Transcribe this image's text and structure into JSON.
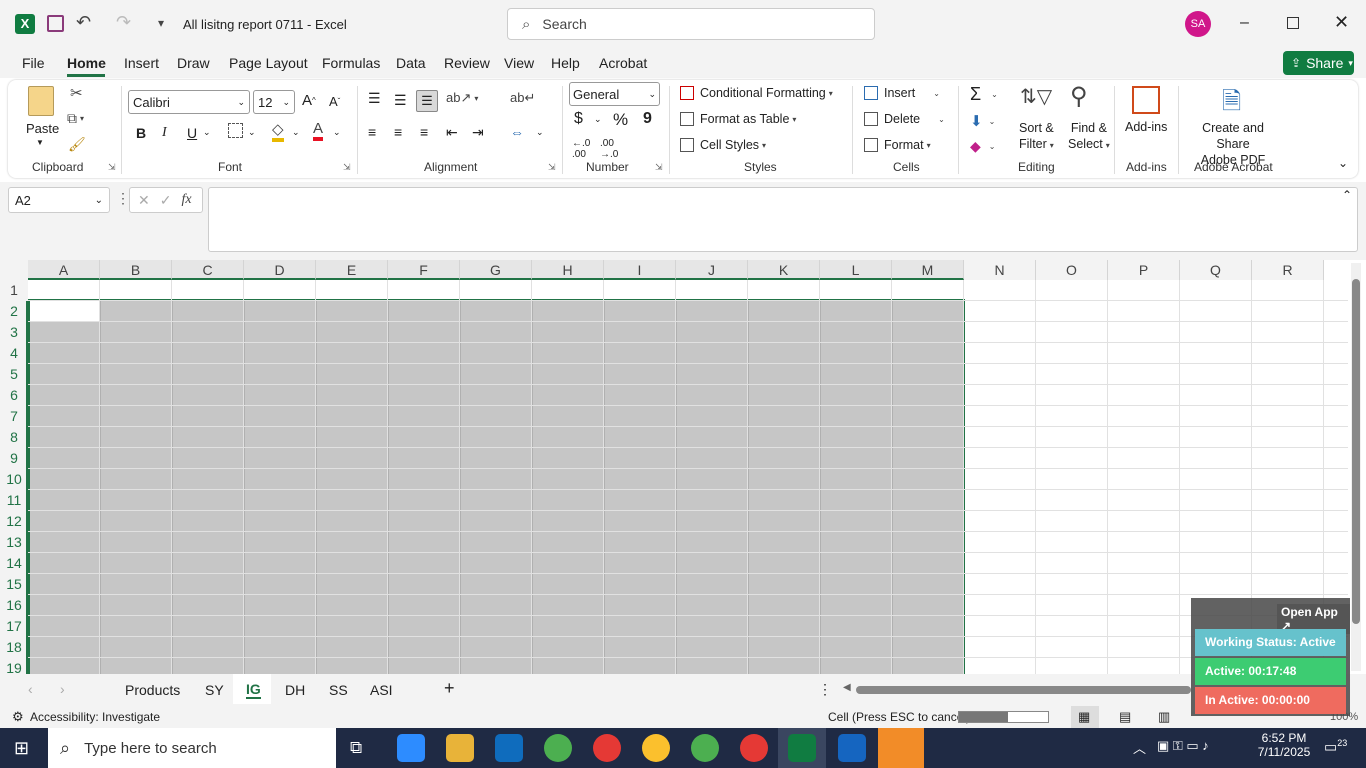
{
  "title_bar": {
    "app_icon": "excel-icon",
    "doc_title": "All lisitng report 0711",
    "app_name": "Excel",
    "search_placeholder": "Search",
    "avatar": "SA"
  },
  "tabs": [
    "File",
    "Home",
    "Insert",
    "Draw",
    "Page Layout",
    "Formulas",
    "Data",
    "Review",
    "View",
    "Help",
    "Acrobat"
  ],
  "share_label": "Share",
  "ribbon": {
    "clipboard": {
      "paste": "Paste",
      "label": "Clipboard"
    },
    "font": {
      "name": "Calibri",
      "size": "12",
      "label": "Font",
      "bold": "B",
      "italic": "I",
      "underline": "U"
    },
    "alignment": {
      "label": "Alignment"
    },
    "number": {
      "format": "General",
      "label": "Number",
      "currency": "$",
      "percent": "%",
      "comma": "9"
    },
    "styles": {
      "conditional": "Conditional Formatting",
      "format_table": "Format as Table",
      "cell_styles": "Cell Styles",
      "label": "Styles"
    },
    "cells": {
      "insert": "Insert",
      "delete": "Delete",
      "format": "Format",
      "label": "Cells"
    },
    "editing": {
      "sort_filter_1": "Sort &",
      "sort_filter_2": "Filter",
      "find_select_1": "Find &",
      "find_select_2": "Select",
      "label": "Editing"
    },
    "addins": {
      "addins": "Add-ins",
      "label": "Add-ins"
    },
    "acrobat": {
      "create_1": "Create and Share",
      "create_2": "Adobe PDF",
      "label": "Adobe Acrobat"
    }
  },
  "name_box": "A2",
  "fx": "fx",
  "columns": [
    "A",
    "B",
    "C",
    "D",
    "E",
    "F",
    "G",
    "H",
    "I",
    "J",
    "K",
    "L",
    "M",
    "N",
    "O",
    "P",
    "Q",
    "R"
  ],
  "rows": [
    "1",
    "2",
    "3",
    "4",
    "5",
    "6",
    "7",
    "8",
    "9",
    "10",
    "11",
    "12",
    "13",
    "14",
    "15",
    "16",
    "17",
    "18",
    "19"
  ],
  "sheets": [
    "Products",
    "SY",
    "IG",
    "DH",
    "SS",
    "ASI"
  ],
  "active_sheet": "IG",
  "status": {
    "accessibility": "Accessibility: Investigate",
    "cell_msg": "Cell (Press ESC to cancel):",
    "zoom": "100%"
  },
  "overlay": {
    "open_app": "Open App ↗",
    "working": "Working Status: Active",
    "active": "Active: 00:17:48",
    "inactive": "In Active: 00:00:00"
  },
  "taskbar": {
    "search_placeholder": "Type here to search",
    "time": "6:52 PM",
    "date": "7/11/2025",
    "notifications": "23"
  },
  "colors": {
    "excel_green": "#217346",
    "selection_gray": "#c6c6c6",
    "share_green": "#107c41"
  }
}
